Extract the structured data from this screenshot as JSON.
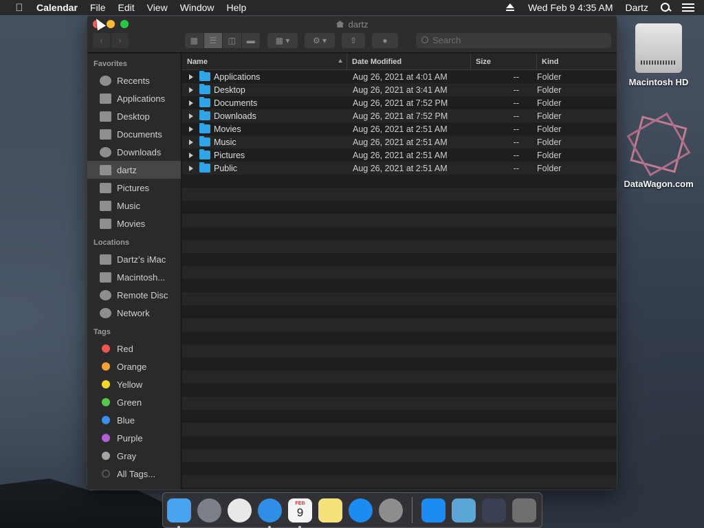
{
  "menubar": {
    "app_name": "Calendar",
    "menus": [
      "File",
      "Edit",
      "View",
      "Window",
      "Help"
    ],
    "clock": "Wed Feb 9  4:35 AM",
    "user": "Dartz"
  },
  "window": {
    "title": "dartz",
    "search_placeholder": "Search",
    "columns": {
      "name": "Name",
      "date": "Date Modified",
      "size": "Size",
      "kind": "Kind"
    },
    "files": [
      {
        "name": "Applications",
        "date": "Aug 26, 2021 at 4:01 AM",
        "size": "--",
        "kind": "Folder"
      },
      {
        "name": "Desktop",
        "date": "Aug 26, 2021 at 3:41 AM",
        "size": "--",
        "kind": "Folder"
      },
      {
        "name": "Documents",
        "date": "Aug 26, 2021 at 7:52 PM",
        "size": "--",
        "kind": "Folder"
      },
      {
        "name": "Downloads",
        "date": "Aug 26, 2021 at 7:52 PM",
        "size": "--",
        "kind": "Folder"
      },
      {
        "name": "Movies",
        "date": "Aug 26, 2021 at 2:51 AM",
        "size": "--",
        "kind": "Folder"
      },
      {
        "name": "Music",
        "date": "Aug 26, 2021 at 2:51 AM",
        "size": "--",
        "kind": "Folder"
      },
      {
        "name": "Pictures",
        "date": "Aug 26, 2021 at 2:51 AM",
        "size": "--",
        "kind": "Folder"
      },
      {
        "name": "Public",
        "date": "Aug 26, 2021 at 2:51 AM",
        "size": "--",
        "kind": "Folder"
      }
    ]
  },
  "sidebar": {
    "favorites_header": "Favorites",
    "favorites": [
      {
        "label": "Recents",
        "icon": "clock-icon"
      },
      {
        "label": "Applications",
        "icon": "applications-icon"
      },
      {
        "label": "Desktop",
        "icon": "desktop-icon"
      },
      {
        "label": "Documents",
        "icon": "document-icon"
      },
      {
        "label": "Downloads",
        "icon": "download-icon"
      },
      {
        "label": "dartz",
        "icon": "home-icon",
        "selected": true
      },
      {
        "label": "Pictures",
        "icon": "camera-icon"
      },
      {
        "label": "Music",
        "icon": "music-note-icon"
      },
      {
        "label": "Movies",
        "icon": "film-icon"
      }
    ],
    "locations_header": "Locations",
    "locations": [
      {
        "label": "Dartz’s iMac",
        "icon": "imac-icon"
      },
      {
        "label": "Macintosh...",
        "icon": "disk-icon"
      },
      {
        "label": "Remote Disc",
        "icon": "disc-icon"
      },
      {
        "label": "Network",
        "icon": "globe-icon"
      }
    ],
    "tags_header": "Tags",
    "tags": [
      {
        "label": "Red",
        "color": "#f0544f"
      },
      {
        "label": "Orange",
        "color": "#f6a030"
      },
      {
        "label": "Yellow",
        "color": "#f7d62a"
      },
      {
        "label": "Green",
        "color": "#58c64a"
      },
      {
        "label": "Blue",
        "color": "#3a8ff0"
      },
      {
        "label": "Purple",
        "color": "#b35fd6"
      },
      {
        "label": "Gray",
        "color": "#a5a5a5"
      },
      {
        "label": "All Tags...",
        "color": "#555555"
      }
    ]
  },
  "desktop": {
    "icons": [
      {
        "label": "Macintosh HD",
        "icon": "hard-drive-icon"
      },
      {
        "label": "DataWagon.com",
        "icon": "datawagon-logo-icon"
      }
    ]
  },
  "dock": {
    "apps": [
      {
        "name": "finder-icon",
        "running": true,
        "color": "#4aa3f0"
      },
      {
        "name": "launchpad-icon",
        "running": false,
        "color": "#7a7f88"
      },
      {
        "name": "chrome-icon",
        "running": false,
        "color": "#e8e8e8"
      },
      {
        "name": "safari-icon",
        "running": true,
        "color": "#2f8fe6"
      },
      {
        "name": "calendar-icon",
        "running": true,
        "color": "#f4f4f4",
        "day": "9",
        "month": "FEB"
      },
      {
        "name": "notes-icon",
        "running": false,
        "color": "#f7e27a"
      },
      {
        "name": "app-store-icon",
        "running": false,
        "color": "#1c8cf2"
      },
      {
        "name": "system-preferences-icon",
        "running": false,
        "color": "#8d8d8d"
      },
      {
        "name": "applications-folder-icon",
        "running": false,
        "color": "#1c8cf2"
      },
      {
        "name": "downloads-folder-icon",
        "running": false,
        "color": "#5aa6d6"
      },
      {
        "name": "screen-recording-icon",
        "running": false,
        "color": "#3b3f55"
      },
      {
        "name": "trash-icon",
        "running": false,
        "color": "#6f6f6f"
      }
    ]
  }
}
